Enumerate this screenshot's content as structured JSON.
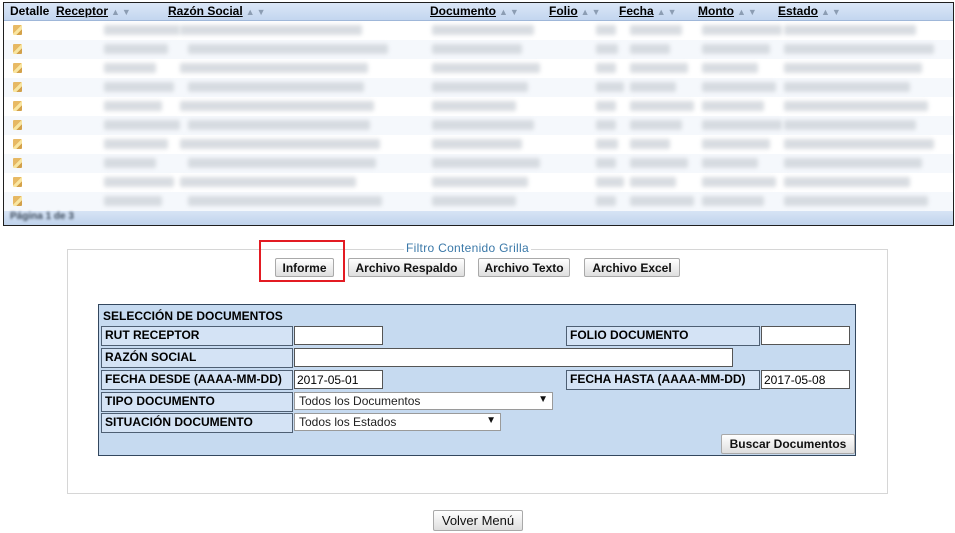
{
  "grid": {
    "columns": [
      {
        "label": "Detalle",
        "sortable": false
      },
      {
        "label": "Receptor",
        "sortable": true
      },
      {
        "label": "Razón Social",
        "sortable": true
      },
      {
        "label": "Documento",
        "sortable": true
      },
      {
        "label": "Folio",
        "sortable": true
      },
      {
        "label": "Fecha",
        "sortable": true
      },
      {
        "label": "Monto",
        "sortable": true
      },
      {
        "label": "Estado",
        "sortable": true
      }
    ],
    "sort_arrows": "▲▼",
    "row_count": 10,
    "pager": "Página 1 de 3"
  },
  "filter": {
    "legend": "Filtro Contenido Grilla",
    "buttons": {
      "informe": "Informe",
      "respaldo": "Archivo Respaldo",
      "texto": "Archivo Texto",
      "excel": "Archivo Excel"
    }
  },
  "selection": {
    "title": "SELECCIÓN DE DOCUMENTOS",
    "rut_receptor_label": "RUT RECEPTOR",
    "rut_receptor_value": "",
    "folio_label": "FOLIO DOCUMENTO",
    "folio_value": "",
    "razon_social_label": "RAZÓN SOCIAL",
    "razon_social_value": "",
    "fecha_desde_label": "FECHA DESDE (AAAA-MM-DD)",
    "fecha_desde_value": "2017-05-01",
    "fecha_hasta_label": "FECHA HASTA (AAAA-MM-DD)",
    "fecha_hasta_value": "2017-05-08",
    "tipo_label": "TIPO DOCUMENTO",
    "tipo_value": "Todos los Documentos",
    "situacion_label": "SITUACIÓN DOCUMENTO",
    "situacion_value": "Todos los Estados",
    "buscar_label": "Buscar Documentos"
  },
  "footer": {
    "volver_label": "Volver Menú"
  },
  "colors": {
    "highlight": "#e31b23",
    "panel_bg": "#c6daf0",
    "legend_text": "#3a78a8"
  }
}
